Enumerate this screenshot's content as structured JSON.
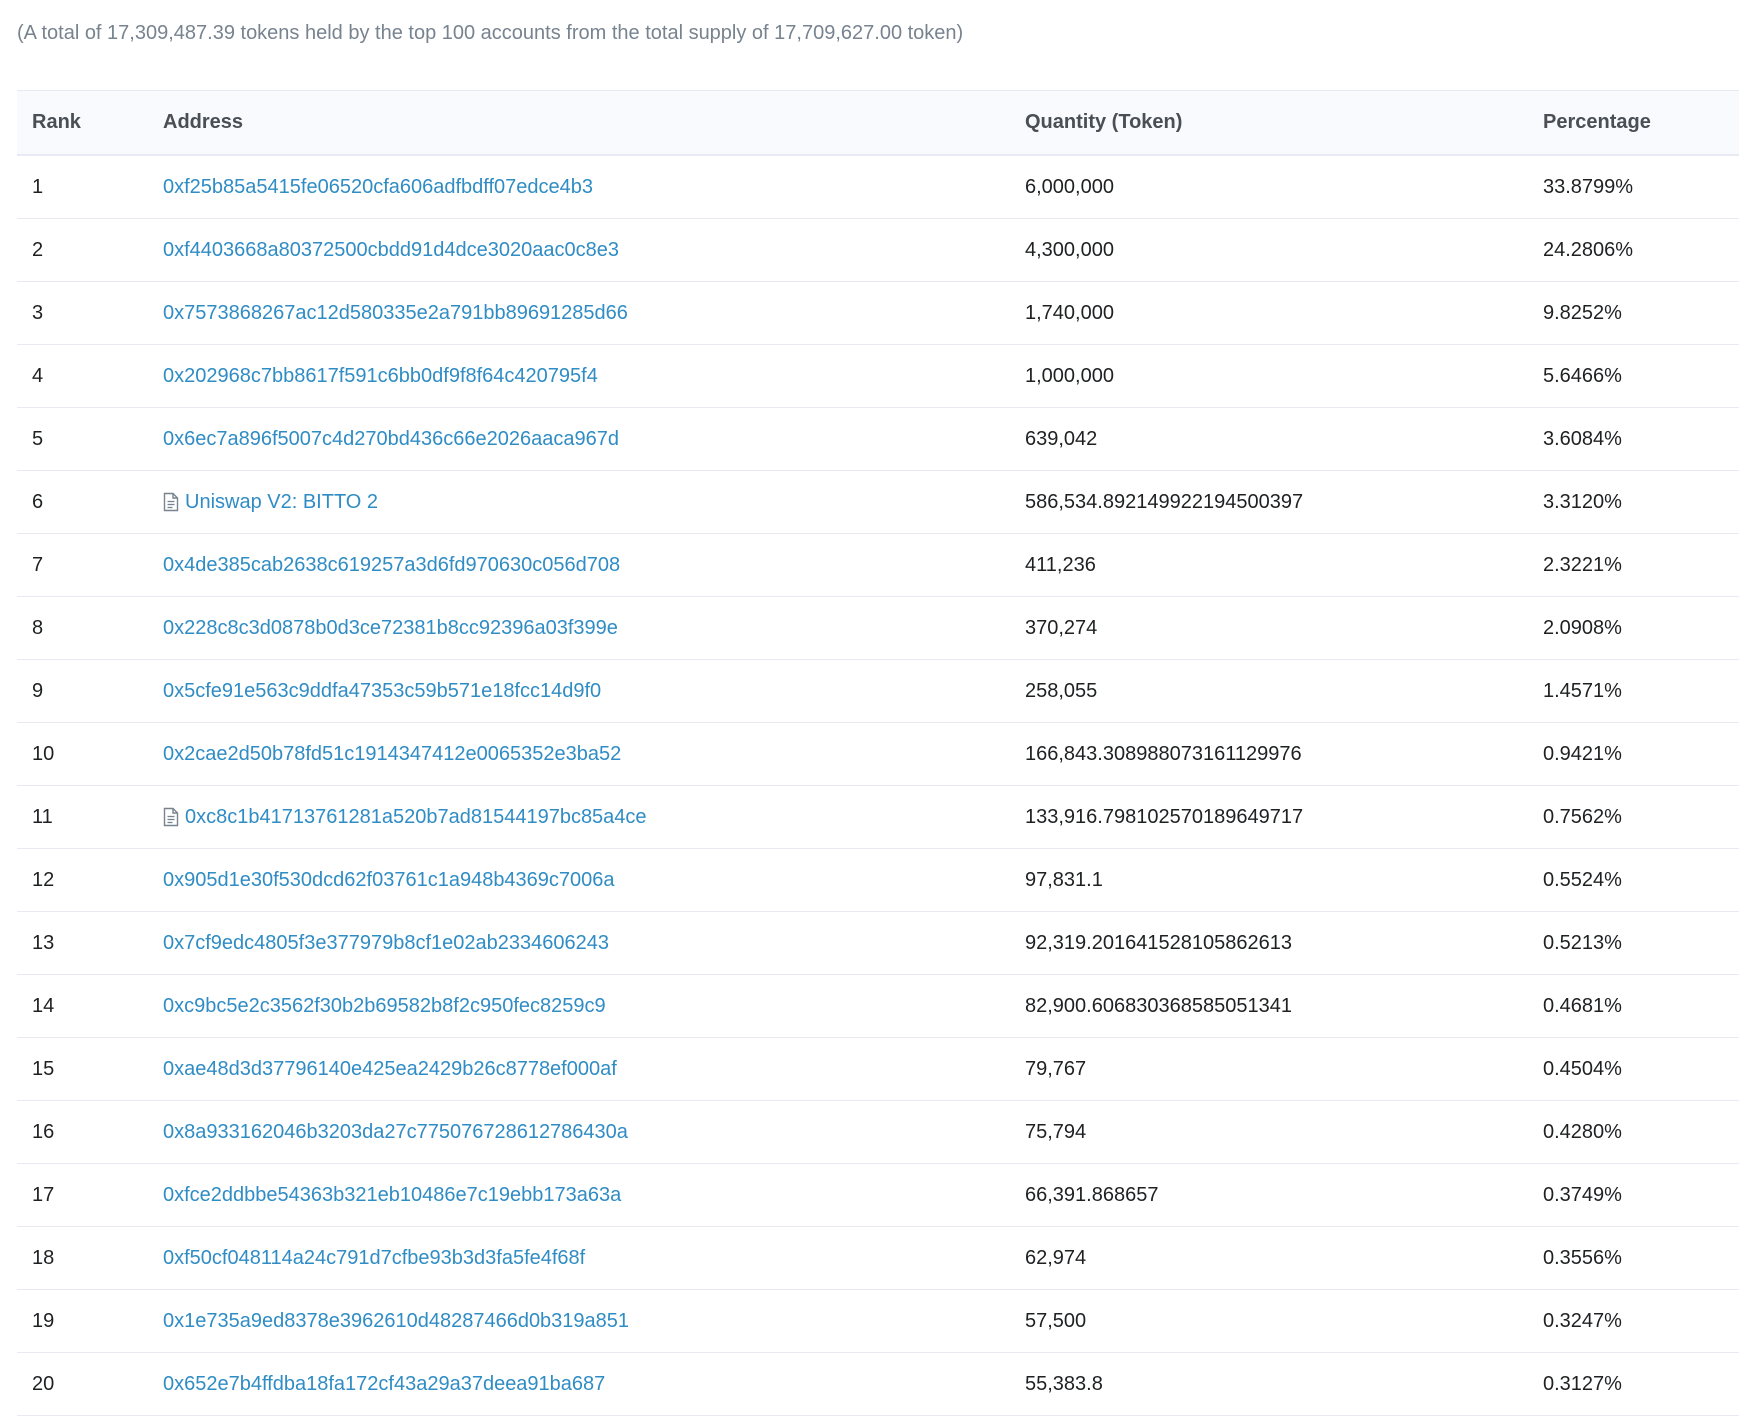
{
  "summary": "(A total of 17,309,487.39 tokens held by the top 100 accounts from the total supply of 17,709,627.00 token)",
  "table": {
    "headers": {
      "rank": "Rank",
      "address": "Address",
      "quantity": "Quantity (Token)",
      "percentage": "Percentage"
    },
    "rows": [
      {
        "rank": "1",
        "address": "0xf25b85a5415fe06520cfa606adfbdff07edce4b3",
        "contract": false,
        "quantity": "6,000,000",
        "percentage": "33.8799%"
      },
      {
        "rank": "2",
        "address": "0xf4403668a80372500cbdd91d4dce3020aac0c8e3",
        "contract": false,
        "quantity": "4,300,000",
        "percentage": "24.2806%"
      },
      {
        "rank": "3",
        "address": "0x7573868267ac12d580335e2a791bb89691285d66",
        "contract": false,
        "quantity": "1,740,000",
        "percentage": "9.8252%"
      },
      {
        "rank": "4",
        "address": "0x202968c7bb8617f591c6bb0df9f8f64c420795f4",
        "contract": false,
        "quantity": "1,000,000",
        "percentage": "5.6466%"
      },
      {
        "rank": "5",
        "address": "0x6ec7a896f5007c4d270bd436c66e2026aaca967d",
        "contract": false,
        "quantity": "639,042",
        "percentage": "3.6084%"
      },
      {
        "rank": "6",
        "address": "Uniswap V2: BITTO 2",
        "contract": true,
        "quantity": "586,534.892149922194500397",
        "percentage": "3.3120%"
      },
      {
        "rank": "7",
        "address": "0x4de385cab2638c619257a3d6fd970630c056d708",
        "contract": false,
        "quantity": "411,236",
        "percentage": "2.3221%"
      },
      {
        "rank": "8",
        "address": "0x228c8c3d0878b0d3ce72381b8cc92396a03f399e",
        "contract": false,
        "quantity": "370,274",
        "percentage": "2.0908%"
      },
      {
        "rank": "9",
        "address": "0x5cfe91e563c9ddfa47353c59b571e18fcc14d9f0",
        "contract": false,
        "quantity": "258,055",
        "percentage": "1.4571%"
      },
      {
        "rank": "10",
        "address": "0x2cae2d50b78fd51c1914347412e0065352e3ba52",
        "contract": false,
        "quantity": "166,843.308988073161129976",
        "percentage": "0.9421%"
      },
      {
        "rank": "11",
        "address": "0xc8c1b41713761281a520b7ad81544197bc85a4ce",
        "contract": true,
        "quantity": "133,916.798102570189649717",
        "percentage": "0.7562%"
      },
      {
        "rank": "12",
        "address": "0x905d1e30f530dcd62f03761c1a948b4369c7006a",
        "contract": false,
        "quantity": "97,831.1",
        "percentage": "0.5524%"
      },
      {
        "rank": "13",
        "address": "0x7cf9edc4805f3e377979b8cf1e02ab2334606243",
        "contract": false,
        "quantity": "92,319.201641528105862613",
        "percentage": "0.5213%"
      },
      {
        "rank": "14",
        "address": "0xc9bc5e2c3562f30b2b69582b8f2c950fec8259c9",
        "contract": false,
        "quantity": "82,900.606830368585051341",
        "percentage": "0.4681%"
      },
      {
        "rank": "15",
        "address": "0xae48d3d37796140e425ea2429b26c8778ef000af",
        "contract": false,
        "quantity": "79,767",
        "percentage": "0.4504%"
      },
      {
        "rank": "16",
        "address": "0x8a933162046b3203da27c775076728612786430a",
        "contract": false,
        "quantity": "75,794",
        "percentage": "0.4280%"
      },
      {
        "rank": "17",
        "address": "0xfce2ddbbe54363b321eb10486e7c19ebb173a63a",
        "contract": false,
        "quantity": "66,391.868657",
        "percentage": "0.3749%"
      },
      {
        "rank": "18",
        "address": "0xf50cf048114a24c791d7cfbe93b3d3fa5fe4f68f",
        "contract": false,
        "quantity": "62,974",
        "percentage": "0.3556%"
      },
      {
        "rank": "19",
        "address": "0x1e735a9ed8378e3962610d48287466d0b319a851",
        "contract": false,
        "quantity": "57,500",
        "percentage": "0.3247%"
      },
      {
        "rank": "20",
        "address": "0x652e7b4ffdba18fa172cf43a29a37deea91ba687",
        "contract": false,
        "quantity": "55,383.8",
        "percentage": "0.3127%"
      }
    ]
  },
  "colors": {
    "link": "#2f8cc4",
    "header_bg": "#f8fafd",
    "border": "#e7eaf3",
    "muted_text": "#77838f"
  },
  "icons": {
    "contract": "file-contract-icon"
  }
}
